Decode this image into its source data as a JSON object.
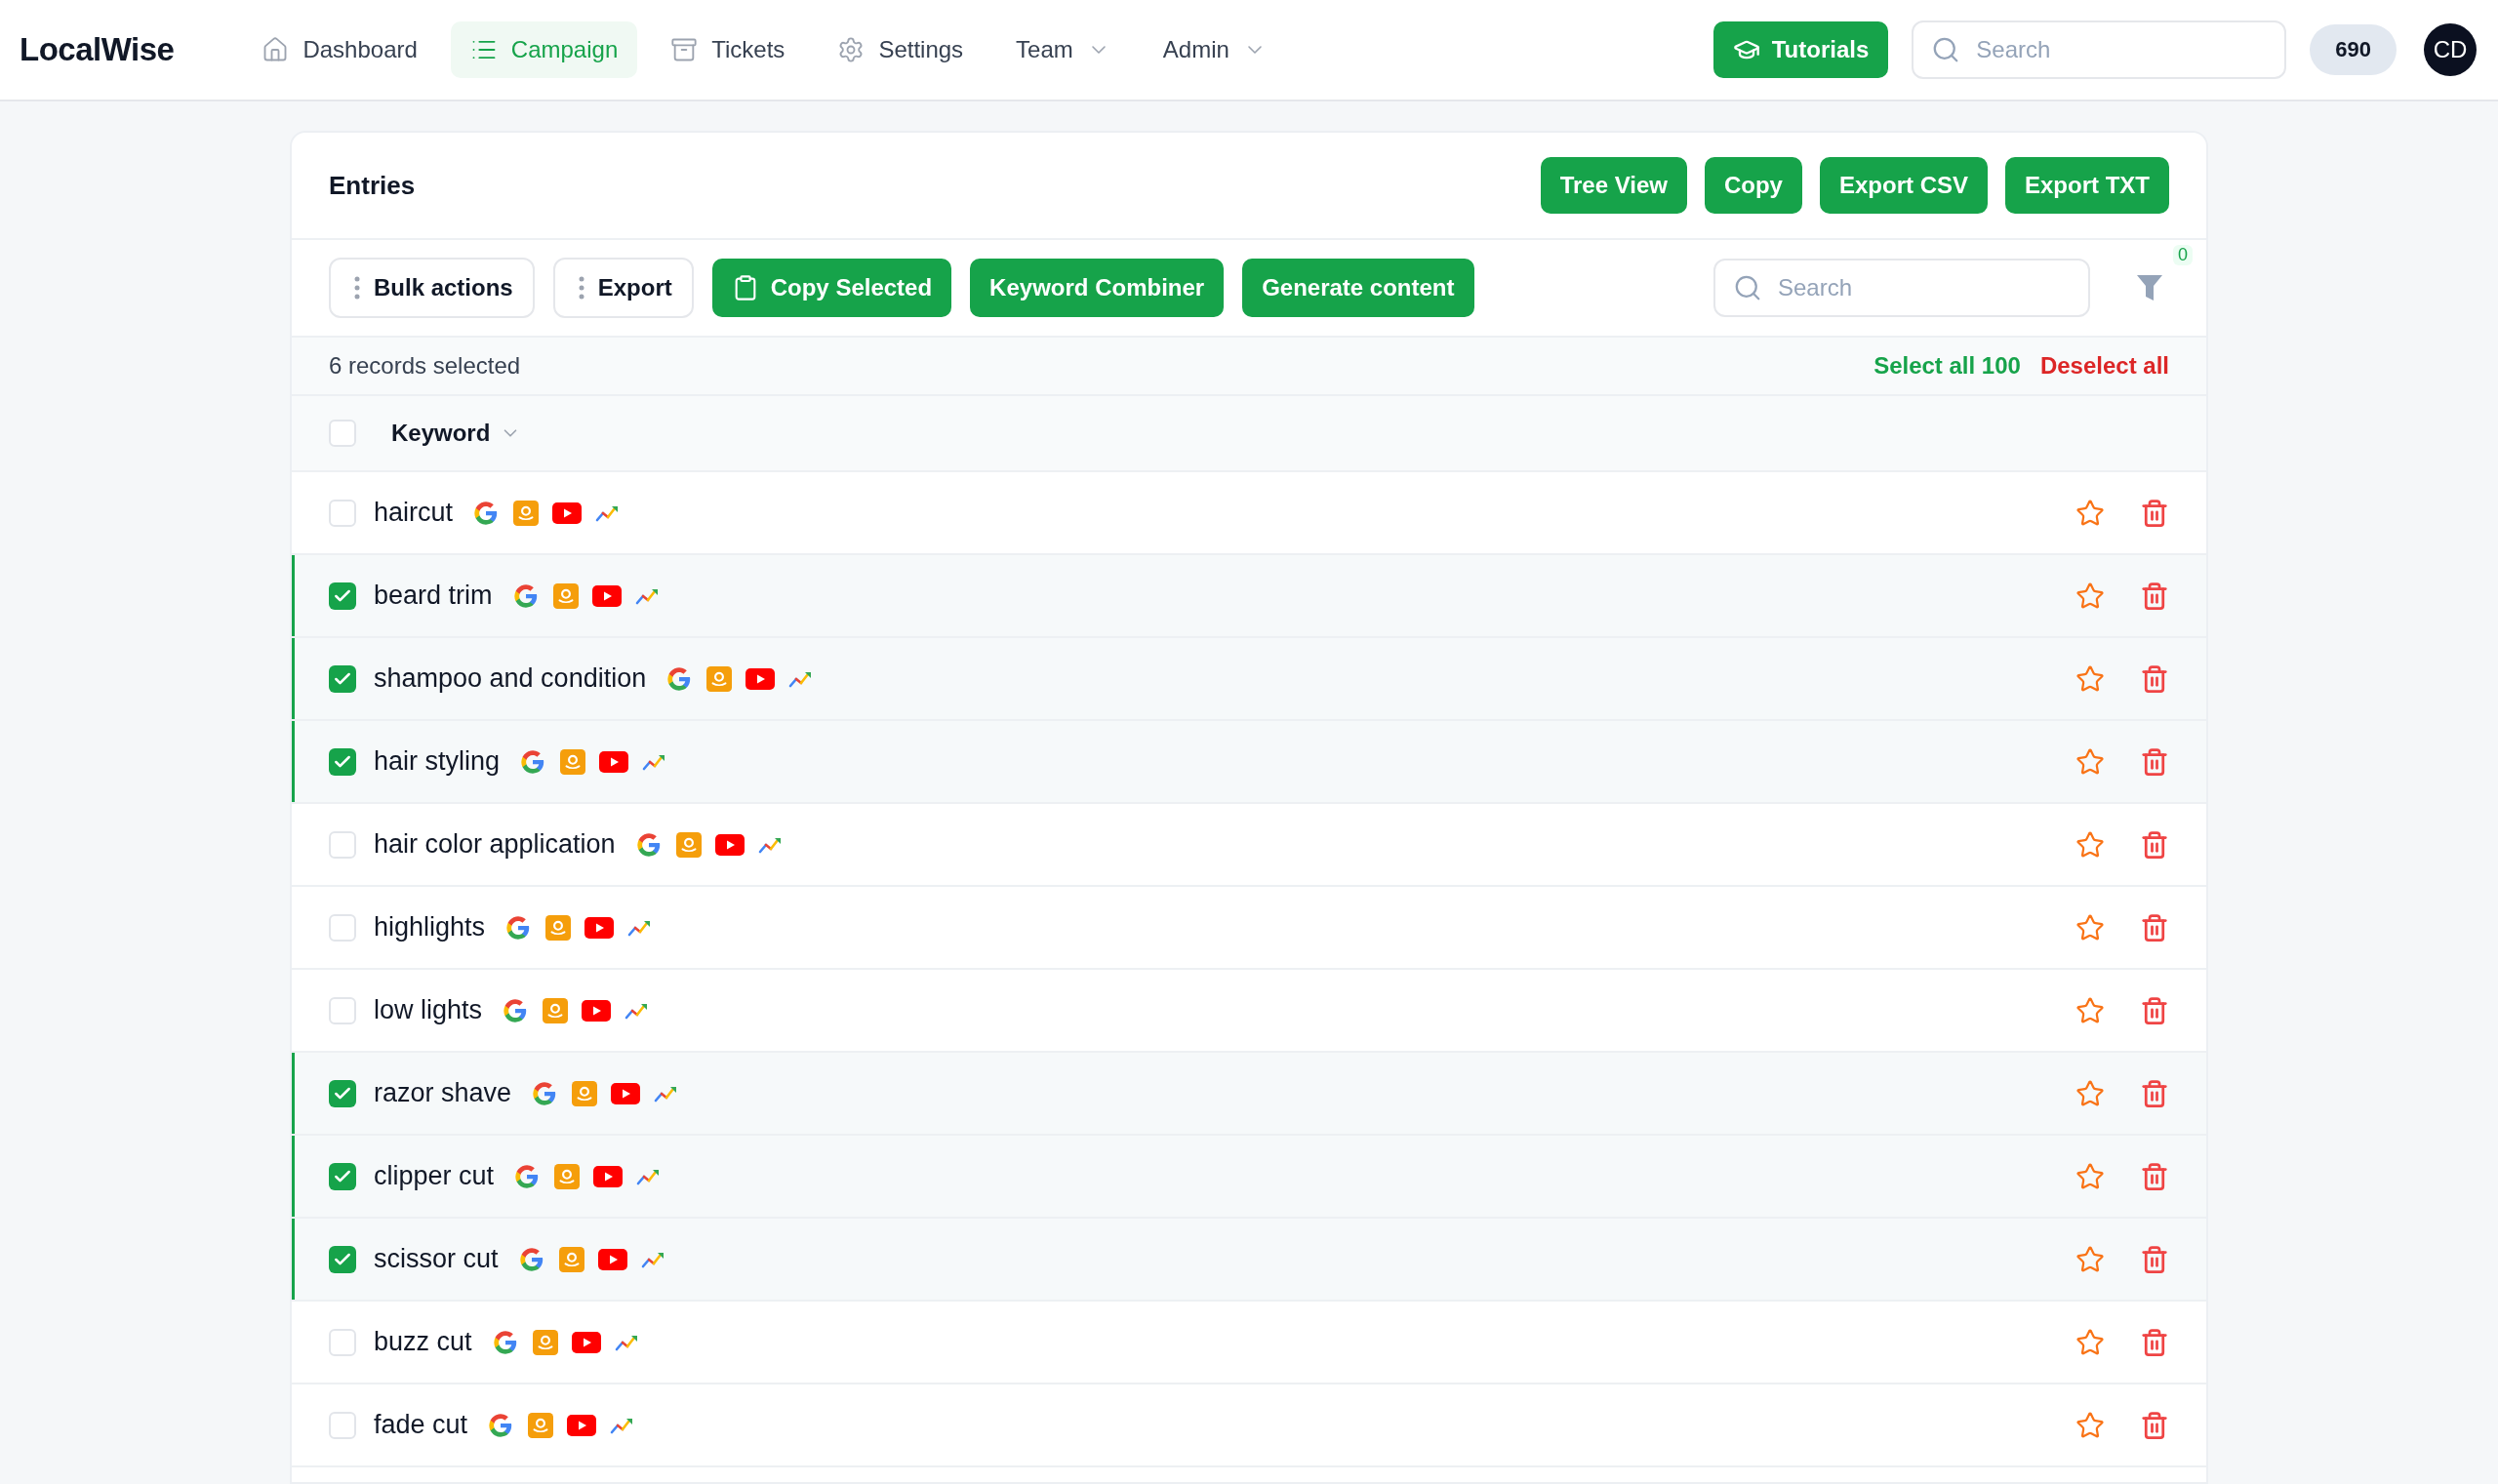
{
  "brand": "LocalWise",
  "nav": [
    {
      "label": "Dashboard",
      "kind": "link",
      "selected": false
    },
    {
      "label": "Campaign",
      "kind": "link",
      "selected": true
    },
    {
      "label": "Tickets",
      "kind": "link",
      "selected": false
    },
    {
      "label": "Settings",
      "kind": "link",
      "selected": false
    },
    {
      "label": "Team",
      "kind": "menu",
      "selected": false
    },
    {
      "label": "Admin",
      "kind": "menu",
      "selected": false
    }
  ],
  "header_actions": {
    "tutorials": "Tutorials",
    "search_placeholder": "Search",
    "credits": "690",
    "avatar": "CD"
  },
  "card": {
    "title": "Entries",
    "actions": [
      "Tree View",
      "Copy",
      "Export CSV",
      "Export TXT"
    ]
  },
  "toolbar": {
    "buttons": [
      {
        "label": "Bulk actions",
        "kind": "menu"
      },
      {
        "label": "Export",
        "kind": "menu"
      },
      {
        "label": "Copy Selected",
        "kind": "copy"
      },
      {
        "label": "Keyword Combiner",
        "kind": "primary"
      },
      {
        "label": "Generate content",
        "kind": "primary"
      }
    ],
    "search_placeholder": "Search",
    "filter_count": "0"
  },
  "selection": {
    "summary": "6 records selected",
    "select_all": "Select all 100",
    "deselect_all": "Deselect all"
  },
  "table": {
    "column": "Keyword",
    "all_checked": false,
    "rows": [
      {
        "keyword": "haircut",
        "selected": false
      },
      {
        "keyword": "beard trim",
        "selected": true
      },
      {
        "keyword": "shampoo and condition",
        "selected": true
      },
      {
        "keyword": "hair styling",
        "selected": true
      },
      {
        "keyword": "hair color application",
        "selected": false
      },
      {
        "keyword": "highlights",
        "selected": false
      },
      {
        "keyword": "low lights",
        "selected": false
      },
      {
        "keyword": "razor shave",
        "selected": true
      },
      {
        "keyword": "clipper cut",
        "selected": true
      },
      {
        "keyword": "scissor cut",
        "selected": true
      },
      {
        "keyword": "buzz cut",
        "selected": false
      },
      {
        "keyword": "fade cut",
        "selected": false
      }
    ]
  }
}
